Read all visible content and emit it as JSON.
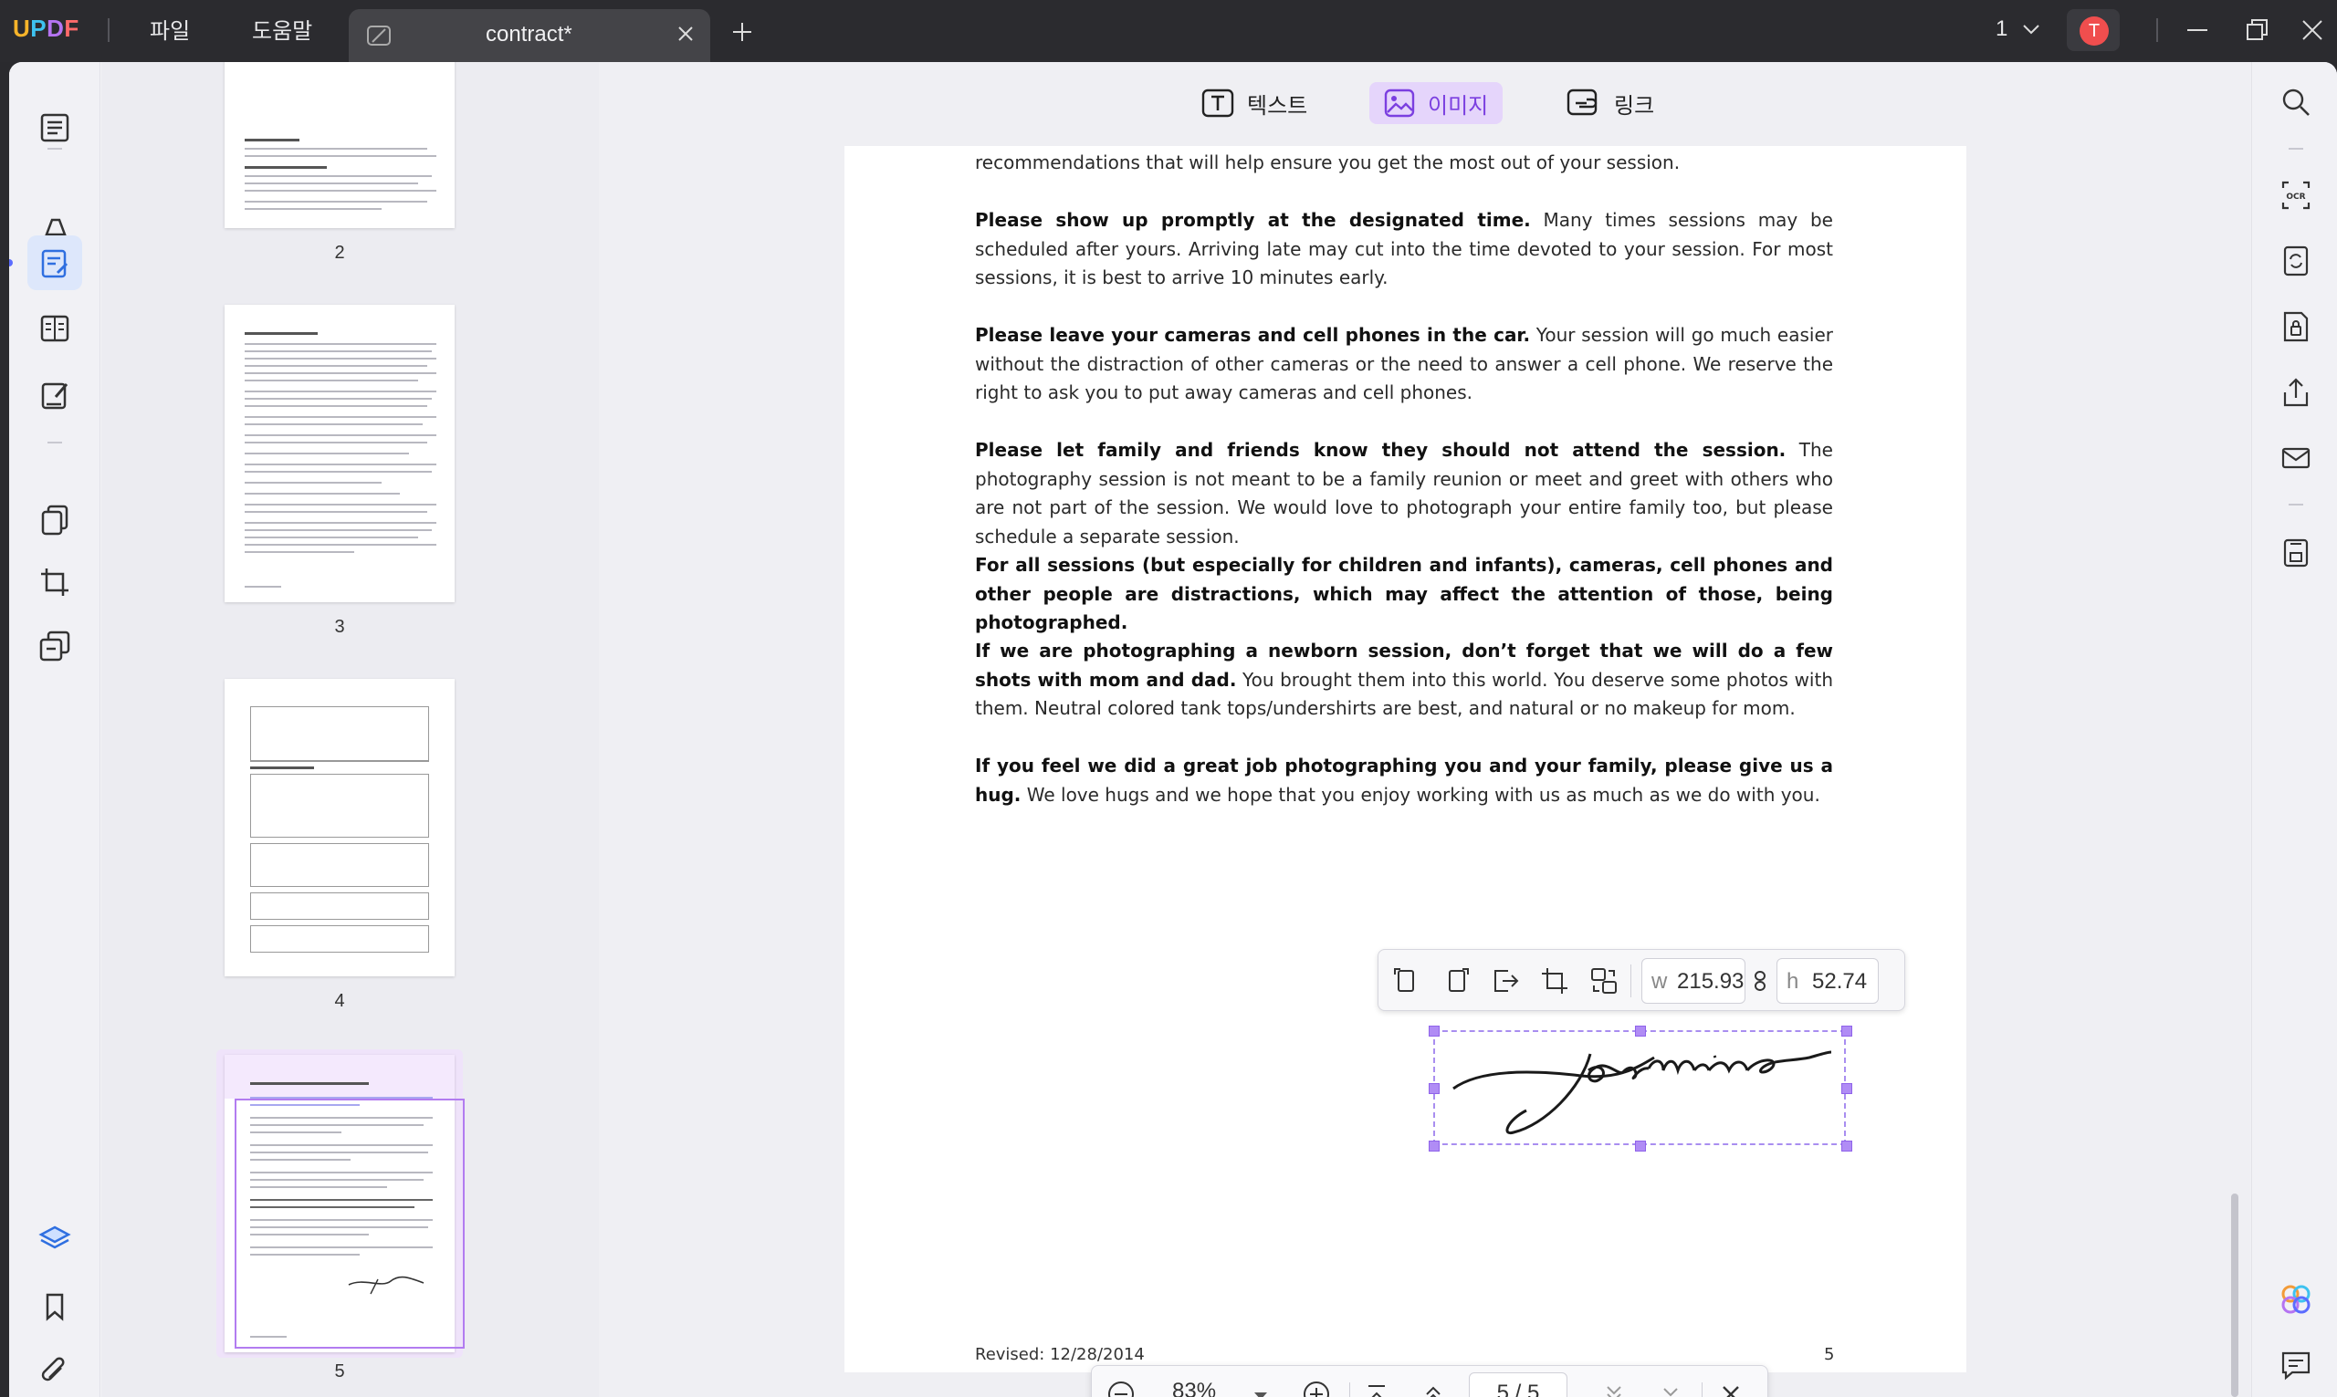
{
  "app": {
    "logo": "UPDF",
    "menu": [
      "파일",
      "도움말"
    ],
    "tab_title": "contract*",
    "page_indicator": "1"
  },
  "user": {
    "initial": "T",
    "avatar_color": "#f04e4e"
  },
  "edit_toolbar": {
    "text_label": "텍스트",
    "image_label": "이미지",
    "link_label": "링크",
    "active": "image"
  },
  "thumbnails": [
    {
      "page": "2"
    },
    {
      "page": "3"
    },
    {
      "page": "4"
    },
    {
      "page": "5",
      "selected": true
    }
  ],
  "document": {
    "intro": "recommendations that will help ensure you get the most out of your session.",
    "paragraphs": [
      {
        "bold": "Please show up promptly at the designated time.",
        "text": " Many times sessions may be scheduled after yours. Arriving late may cut into the time devoted to your session. For most sessions, it is best to arrive 10 minutes early."
      },
      {
        "bold": "Please leave your cameras and cell phones in the car.",
        "text": " Your session will go much easier without the distraction of other cameras or the need to answer a cell phone. We reserve the right to ask you to put away cameras and cell phones."
      },
      {
        "bold": "Please let family and friends know they should not attend the session.",
        "text": " The photography session is not meant to be a family reunion or meet and greet with others who are not part of the session. We would love to photograph your entire family too, but please schedule a separate session."
      },
      {
        "bold": "For all sessions (but especially for children and infants), cameras, cell phones and other people are distractions, which may affect the attention of those, being photographed.",
        "text": ""
      },
      {
        "bold": "If we are photographing a newborn session, don’t forget that we will do a few shots with mom and dad.",
        "text": " You brought them into this world. You deserve some photos with them. Neutral colored tank tops/undershirts are best, and natural or no makeup for mom."
      },
      {
        "bold": "If you feel we did a great job photographing you and your family, please give us a hug.",
        "text": " We love hugs and we hope that you enjoy working with us as much as we do with you."
      }
    ],
    "signature": "jasmine",
    "footer_revised": "Revised: 12/28/2014",
    "footer_page": "5"
  },
  "image_toolbar": {
    "w_label": "w",
    "w_value": "215.93",
    "h_label": "h",
    "h_value": "52.74"
  },
  "bottom_bar": {
    "zoom": "83%",
    "page_current": "5",
    "page_total": "5",
    "page_display": "5 / 5"
  },
  "colors": {
    "accent": "#7b3fe0",
    "selection": "#b08cf5",
    "titlebar": "#2b2b2f"
  }
}
